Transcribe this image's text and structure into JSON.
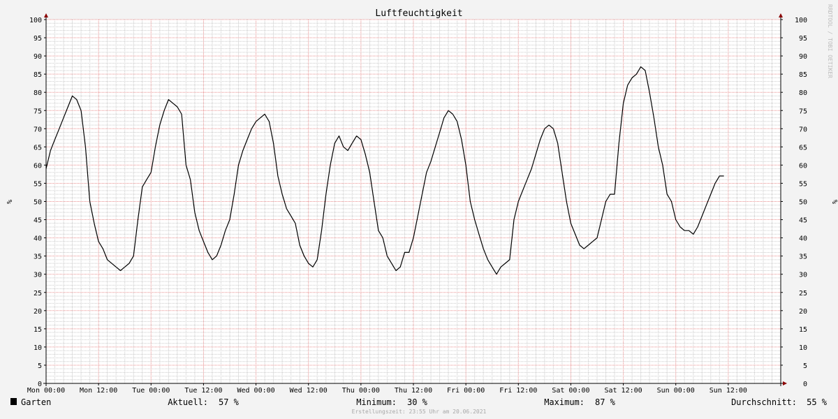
{
  "chart_data": {
    "type": "line",
    "title": "Luftfeuchtigkeit",
    "ylabel": "%",
    "ylim": [
      0,
      100
    ],
    "y_ticks": [
      0,
      5,
      10,
      15,
      20,
      25,
      30,
      35,
      40,
      45,
      50,
      55,
      60,
      65,
      70,
      75,
      80,
      85,
      90,
      95,
      100
    ],
    "x_range_hours": [
      0,
      168
    ],
    "x_ticks": [
      {
        "label": "Mon 00:00",
        "hour": 0
      },
      {
        "label": "Mon 12:00",
        "hour": 12
      },
      {
        "label": "Tue 00:00",
        "hour": 24
      },
      {
        "label": "Tue 12:00",
        "hour": 36
      },
      {
        "label": "Wed 00:00",
        "hour": 48
      },
      {
        "label": "Wed 12:00",
        "hour": 60
      },
      {
        "label": "Thu 00:00",
        "hour": 72
      },
      {
        "label": "Thu 12:00",
        "hour": 84
      },
      {
        "label": "Fri 00:00",
        "hour": 96
      },
      {
        "label": "Fri 12:00",
        "hour": 108
      },
      {
        "label": "Sat 00:00",
        "hour": 120
      },
      {
        "label": "Sat 12:00",
        "hour": 132
      },
      {
        "label": "Sun 00:00",
        "hour": 144
      },
      {
        "label": "Sun 12:00",
        "hour": 156
      }
    ],
    "grid": true,
    "series": [
      {
        "name": "Garten",
        "color": "#000000",
        "points": [
          [
            0,
            59
          ],
          [
            1,
            64
          ],
          [
            2,
            67
          ],
          [
            3,
            70
          ],
          [
            4,
            73
          ],
          [
            5,
            76
          ],
          [
            6,
            79
          ],
          [
            7,
            78
          ],
          [
            8,
            75
          ],
          [
            9,
            65
          ],
          [
            10,
            50
          ],
          [
            11,
            44
          ],
          [
            12,
            39
          ],
          [
            13,
            37
          ],
          [
            14,
            34
          ],
          [
            15,
            33
          ],
          [
            16,
            32
          ],
          [
            17,
            31
          ],
          [
            18,
            32
          ],
          [
            19,
            33
          ],
          [
            20,
            35
          ],
          [
            21,
            45
          ],
          [
            22,
            54
          ],
          [
            23,
            56
          ],
          [
            24,
            58
          ],
          [
            25,
            65
          ],
          [
            26,
            71
          ],
          [
            27,
            75
          ],
          [
            28,
            78
          ],
          [
            29,
            77
          ],
          [
            30,
            76
          ],
          [
            31,
            74
          ],
          [
            32,
            60
          ],
          [
            33,
            56
          ],
          [
            34,
            47
          ],
          [
            35,
            42
          ],
          [
            36,
            39
          ],
          [
            37,
            36
          ],
          [
            38,
            34
          ],
          [
            39,
            35
          ],
          [
            40,
            38
          ],
          [
            41,
            42
          ],
          [
            42,
            45
          ],
          [
            43,
            52
          ],
          [
            44,
            60
          ],
          [
            45,
            64
          ],
          [
            46,
            67
          ],
          [
            47,
            70
          ],
          [
            48,
            72
          ],
          [
            49,
            73
          ],
          [
            50,
            74
          ],
          [
            51,
            72
          ],
          [
            52,
            66
          ],
          [
            53,
            57
          ],
          [
            54,
            52
          ],
          [
            55,
            48
          ],
          [
            56,
            46
          ],
          [
            57,
            44
          ],
          [
            58,
            38
          ],
          [
            59,
            35
          ],
          [
            60,
            33
          ],
          [
            61,
            32
          ],
          [
            62,
            34
          ],
          [
            63,
            42
          ],
          [
            64,
            52
          ],
          [
            65,
            60
          ],
          [
            66,
            66
          ],
          [
            67,
            68
          ],
          [
            68,
            65
          ],
          [
            69,
            64
          ],
          [
            70,
            66
          ],
          [
            71,
            68
          ],
          [
            72,
            67
          ],
          [
            73,
            63
          ],
          [
            74,
            58
          ],
          [
            75,
            50
          ],
          [
            76,
            42
          ],
          [
            77,
            40
          ],
          [
            78,
            35
          ],
          [
            79,
            33
          ],
          [
            80,
            31
          ],
          [
            81,
            32
          ],
          [
            82,
            36
          ],
          [
            83,
            36
          ],
          [
            84,
            40
          ],
          [
            85,
            46
          ],
          [
            86,
            52
          ],
          [
            87,
            58
          ],
          [
            88,
            61
          ],
          [
            89,
            65
          ],
          [
            90,
            69
          ],
          [
            91,
            73
          ],
          [
            92,
            75
          ],
          [
            93,
            74
          ],
          [
            94,
            72
          ],
          [
            95,
            67
          ],
          [
            96,
            60
          ],
          [
            97,
            50
          ],
          [
            98,
            45
          ],
          [
            99,
            41
          ],
          [
            100,
            37
          ],
          [
            101,
            34
          ],
          [
            102,
            32
          ],
          [
            103,
            30
          ],
          [
            104,
            32
          ],
          [
            105,
            33
          ],
          [
            106,
            34
          ],
          [
            107,
            45
          ],
          [
            108,
            50
          ],
          [
            109,
            53
          ],
          [
            110,
            56
          ],
          [
            111,
            59
          ],
          [
            112,
            63
          ],
          [
            113,
            67
          ],
          [
            114,
            70
          ],
          [
            115,
            71
          ],
          [
            116,
            70
          ],
          [
            117,
            66
          ],
          [
            118,
            58
          ],
          [
            119,
            50
          ],
          [
            120,
            44
          ],
          [
            121,
            41
          ],
          [
            122,
            38
          ],
          [
            123,
            37
          ],
          [
            124,
            38
          ],
          [
            125,
            39
          ],
          [
            126,
            40
          ],
          [
            127,
            45
          ],
          [
            128,
            50
          ],
          [
            129,
            52
          ],
          [
            130,
            52
          ],
          [
            131,
            66
          ],
          [
            132,
            77
          ],
          [
            133,
            82
          ],
          [
            134,
            84
          ],
          [
            135,
            85
          ],
          [
            136,
            87
          ],
          [
            137,
            86
          ],
          [
            138,
            80
          ],
          [
            139,
            73
          ],
          [
            140,
            65
          ],
          [
            141,
            60
          ],
          [
            142,
            52
          ],
          [
            143,
            50
          ],
          [
            144,
            45
          ],
          [
            145,
            43
          ],
          [
            146,
            42
          ],
          [
            147,
            42
          ],
          [
            148,
            41
          ],
          [
            149,
            43
          ],
          [
            150,
            46
          ],
          [
            151,
            49
          ],
          [
            152,
            52
          ],
          [
            153,
            55
          ],
          [
            154,
            57
          ],
          [
            155,
            57
          ]
        ]
      }
    ]
  },
  "legend": {
    "series_name": "Garten",
    "series_color": "#000000",
    "stats": [
      {
        "label": "Aktuell:",
        "value": "57 %"
      },
      {
        "label": "Minimum:",
        "value": "30 %"
      },
      {
        "label": "Maximum:",
        "value": "87 %"
      },
      {
        "label": "Durchschnitt:",
        "value": "55 %"
      }
    ]
  },
  "footer": "Erstellungszeit: 23:55 Uhr am 20.06.2021",
  "watermark": "RRDTOOL / TOBI OETIKER",
  "colors": {
    "background": "#f3f3f3",
    "plot_background": "#ffffff",
    "major_grid": "#e88c8c",
    "minor_grid": "#c9c9c9",
    "axis": "#000000",
    "arrow": "#8b0000"
  }
}
